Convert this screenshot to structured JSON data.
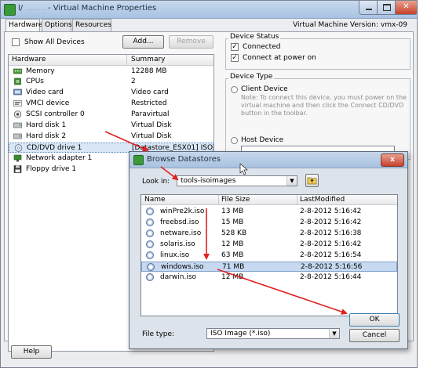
{
  "window": {
    "title_prefix": "l/",
    "title_blur": "........",
    "title": "- Virtual Machine Properties",
    "vm_version": "Virtual Machine Version: vmx-09"
  },
  "tabs": [
    {
      "label": "Hardware",
      "active": true
    },
    {
      "label": "Options",
      "active": false
    },
    {
      "label": "Resources",
      "active": false
    }
  ],
  "hardware_panel": {
    "show_all_devices": "Show All Devices",
    "add_button": "Add...",
    "remove_button": "Remove",
    "col_hardware": "Hardware",
    "col_summary": "Summary",
    "devices": [
      {
        "name": "Memory",
        "summary": "12288 MB",
        "icon": "memory-icon"
      },
      {
        "name": "CPUs",
        "summary": "2",
        "icon": "cpu-icon"
      },
      {
        "name": "Video card",
        "summary": "Video card",
        "icon": "video-card-icon"
      },
      {
        "name": "VMCI device",
        "summary": "Restricted",
        "icon": "vmci-icon"
      },
      {
        "name": "SCSI controller 0",
        "summary": "Paravirtual",
        "icon": "scsi-controller-icon"
      },
      {
        "name": "Hard disk 1",
        "summary": "Virtual Disk",
        "icon": "hard-disk-icon"
      },
      {
        "name": "Hard disk 2",
        "summary": "Virtual Disk",
        "icon": "hard-disk-icon"
      },
      {
        "name": "CD/DVD drive 1",
        "summary": "[Datastore_ESX01] ISO...",
        "icon": "cd-dvd-icon",
        "selected": true
      },
      {
        "name": "Network adapter 1",
        "summary": "",
        "icon": "network-adapter-icon"
      },
      {
        "name": "Floppy drive 1",
        "summary": "",
        "icon": "floppy-icon"
      }
    ],
    "help_button": "Help"
  },
  "device_status": {
    "title": "Device Status",
    "connected": "Connected",
    "connect_at_power_on": "Connect at power on"
  },
  "device_type": {
    "title": "Device Type",
    "client_device": "Client Device",
    "client_note": "Note: To connect this device, you must power on the virtual machine and then click the Connect CD/DVD button in the toolbar.",
    "host_device": "Host Device"
  },
  "browse_dialog": {
    "title": "Browse Datastores",
    "close_label": "x",
    "look_in_label": "Look in:",
    "look_in_value": "tools-isoimages",
    "col_name": "Name",
    "col_size": "File Size",
    "col_modified": "LastModified",
    "files": [
      {
        "name": "winPre2k.iso",
        "size": "13 MB",
        "modified": "2-8-2012 5:16:42"
      },
      {
        "name": "freebsd.iso",
        "size": "15 MB",
        "modified": "2-8-2012 5:16:42"
      },
      {
        "name": "netware.iso",
        "size": "528 KB",
        "modified": "2-8-2012 5:16:38"
      },
      {
        "name": "solaris.iso",
        "size": "12 MB",
        "modified": "2-8-2012 5:16:42"
      },
      {
        "name": "linux.iso",
        "size": "63 MB",
        "modified": "2-8-2012 5:16:54"
      },
      {
        "name": "windows.iso",
        "size": "71 MB",
        "modified": "2-8-2012 5:16:56",
        "selected": true
      },
      {
        "name": "darwin.iso",
        "size": "12 MB",
        "modified": "2-8-2012 5:16:44"
      }
    ],
    "file_type_label": "File type:",
    "file_type_value": "ISO Image (*.iso)",
    "ok_button": "OK",
    "cancel_button": "Cancel"
  },
  "colors": {
    "annotation_arrow": "#e02020",
    "selection": "#c6d9f0"
  }
}
